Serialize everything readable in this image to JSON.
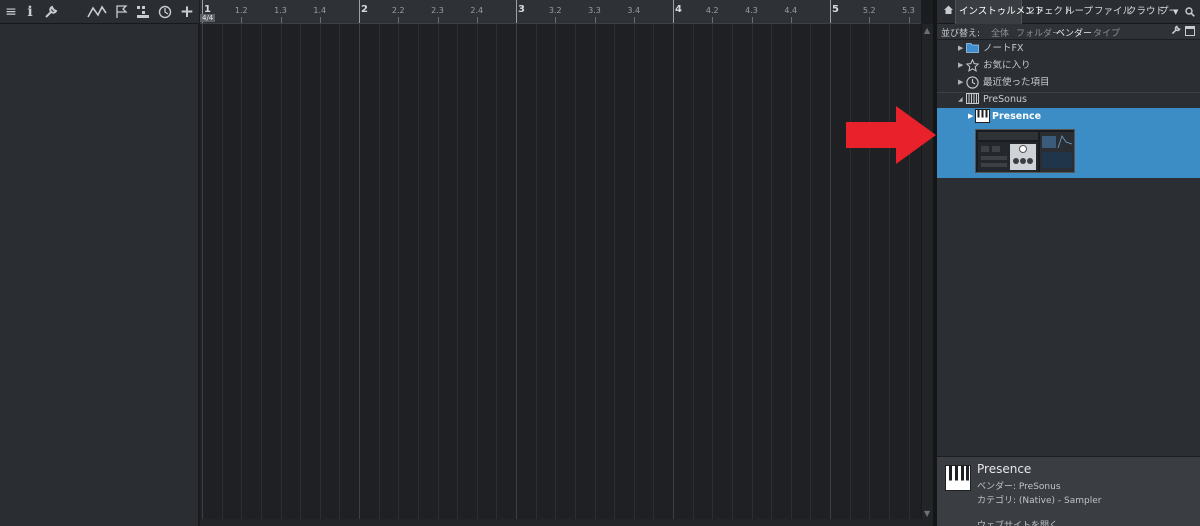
{
  "toolbar": {
    "icons": [
      "menu-icon",
      "info-icon",
      "wrench-icon",
      "automation-icon",
      "marker-flag-icon",
      "snap-grid-icon",
      "clock-icon",
      "add-icon"
    ]
  },
  "ruler": {
    "time_signature": "4/4",
    "labels": [
      "1",
      "1.2",
      "1.3",
      "1.4",
      "2",
      "2.2",
      "2.3",
      "2.4",
      "3",
      "3.2",
      "3.3",
      "3.4",
      "4",
      "4.2",
      "4.3",
      "4.4",
      "5",
      "5.2",
      "5.3"
    ]
  },
  "browser": {
    "tabs": [
      "インストゥルメント",
      "エフェクト",
      "ループ",
      "ファイル",
      "クラウド",
      "プー"
    ],
    "active_tab": "インストゥルメント",
    "sort_by_label": "並び替え:",
    "sort_options": [
      "全体",
      "フォルダー",
      "ベンダー",
      "タイプ"
    ],
    "active_sort": "ベンダー",
    "tree": {
      "note_fx": "ノートFX",
      "favorites": "お気に入り",
      "recent": "最近使った項目",
      "vendor": "PreSonus",
      "instrument": "Presence"
    },
    "info": {
      "name": "Presence",
      "vendor_line": "ベンダー:  PreSonus",
      "category_line": "カテゴリ:  (Native) - Sampler",
      "website_link": "ウェブサイトを開く"
    }
  },
  "colors": {
    "selection": "#3c8dc5",
    "annotation_arrow": "#e8212a"
  }
}
